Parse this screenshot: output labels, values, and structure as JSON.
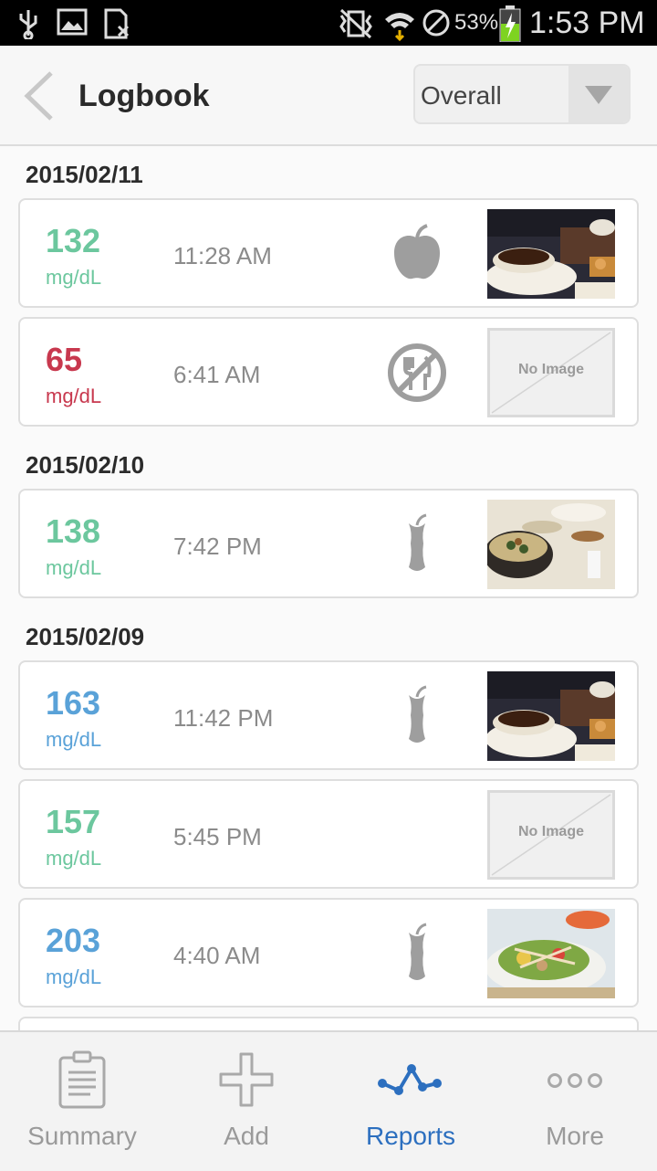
{
  "status_bar": {
    "battery_percent": "53%",
    "time": "1:53 PM"
  },
  "header": {
    "title": "Logbook",
    "filter_value": "Overall"
  },
  "entries": [
    {
      "date": "2015/02/11"
    },
    {
      "value": "132",
      "unit": "mg/dL",
      "time": "11:28 AM",
      "level": "green",
      "meal_icon": "apple-icon",
      "image": "coffee-photo"
    },
    {
      "value": "65",
      "unit": "mg/dL",
      "time": "6:41 AM",
      "level": "red",
      "meal_icon": "no-meal-icon",
      "image": "No Image"
    },
    {
      "date": "2015/02/10"
    },
    {
      "value": "138",
      "unit": "mg/dL",
      "time": "7:42 PM",
      "level": "green",
      "meal_icon": "apple-core-icon",
      "image": "meal-photo"
    },
    {
      "date": "2015/02/09"
    },
    {
      "value": "163",
      "unit": "mg/dL",
      "time": "11:42 PM",
      "level": "blue",
      "meal_icon": "apple-core-icon",
      "image": "coffee-photo"
    },
    {
      "value": "157",
      "unit": "mg/dL",
      "time": "5:45 PM",
      "level": "green",
      "meal_icon": "none",
      "image": "No Image"
    },
    {
      "value": "203",
      "unit": "mg/dL",
      "time": "4:40 AM",
      "level": "blue",
      "meal_icon": "apple-core-icon",
      "image": "salad-photo"
    }
  ],
  "colors": {
    "green": "#6cc79e",
    "red": "#c8384e",
    "blue": "#5aa2d8",
    "active_tab": "#2c6fbf"
  },
  "nav": {
    "summary": "Summary",
    "add": "Add",
    "reports": "Reports",
    "more": "More",
    "active": "Reports"
  }
}
